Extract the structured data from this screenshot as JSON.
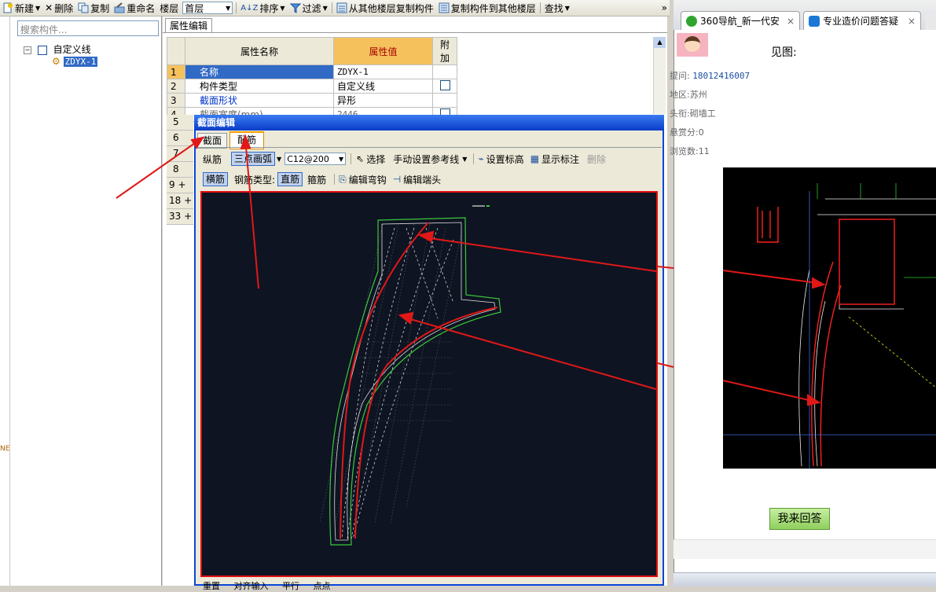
{
  "toolbar": {
    "new_label": "新建",
    "delete_label": "删除",
    "copy_label": "复制",
    "rename_label": "重命名",
    "floor_label": "楼层",
    "floor_value": "首层",
    "sort_label": "排序",
    "filter_label": "过滤",
    "copy_from_floor_label": "从其他楼层复制构件",
    "copy_to_floor_label": "复制构件到其他楼层",
    "find_label": "查找",
    "more_label": "»"
  },
  "left": {
    "search_placeholder": "搜索构件...",
    "tree_root": "自定义线",
    "tree_child": "ZDYX-1"
  },
  "props": {
    "tab_label": "属性编辑",
    "col_name": "属性名称",
    "col_value": "属性值",
    "col_extra": "附加",
    "rows": [
      {
        "n": "1",
        "name": "名称",
        "value": "ZDYX-1"
      },
      {
        "n": "2",
        "name": "构件类型",
        "value": "自定义线"
      },
      {
        "n": "3",
        "name": "截面形状",
        "value": "异形"
      },
      {
        "n": "4",
        "name": "截面宽度(mm)",
        "value": "2446"
      }
    ],
    "more_rows": [
      "5",
      "6",
      "7",
      "8",
      "9",
      "18",
      "33"
    ]
  },
  "dialog": {
    "title": "截面编辑",
    "tab_section": "截面",
    "tab_rebar": "配筋",
    "row1": {
      "longitudinal": "纵筋",
      "arc_mode": "三点画弧",
      "spec": "C12@200",
      "select": "选择",
      "manual_ref": "手动设置参考线",
      "set_elev": "设置标高",
      "show_dim": "显示标注",
      "delete": "删除"
    },
    "row2": {
      "transverse": "横筋",
      "type_label": "钢筋类型:",
      "straight": "直筋",
      "stirrup": "箍筋",
      "edit_hook": "编辑弯钩",
      "edit_end": "编辑端头"
    },
    "bottom": {
      "b1": "重置",
      "b2": "对齐输入",
      "b3": "平行",
      "b4": "点点"
    }
  },
  "browser": {
    "tab1": "360导航_新一代安",
    "tab2": "专业造价问题答疑",
    "see_figure": "见图:",
    "phone_label": "提问:",
    "phone": "18012416007",
    "area_label": "地区:",
    "area": "苏州",
    "title_label": "头衔:",
    "title_value": "砌墙工",
    "reward_label": "悬赏分:",
    "reward": "0",
    "views_label": "浏览数:",
    "views": "11",
    "answer_button": "我来回答"
  }
}
